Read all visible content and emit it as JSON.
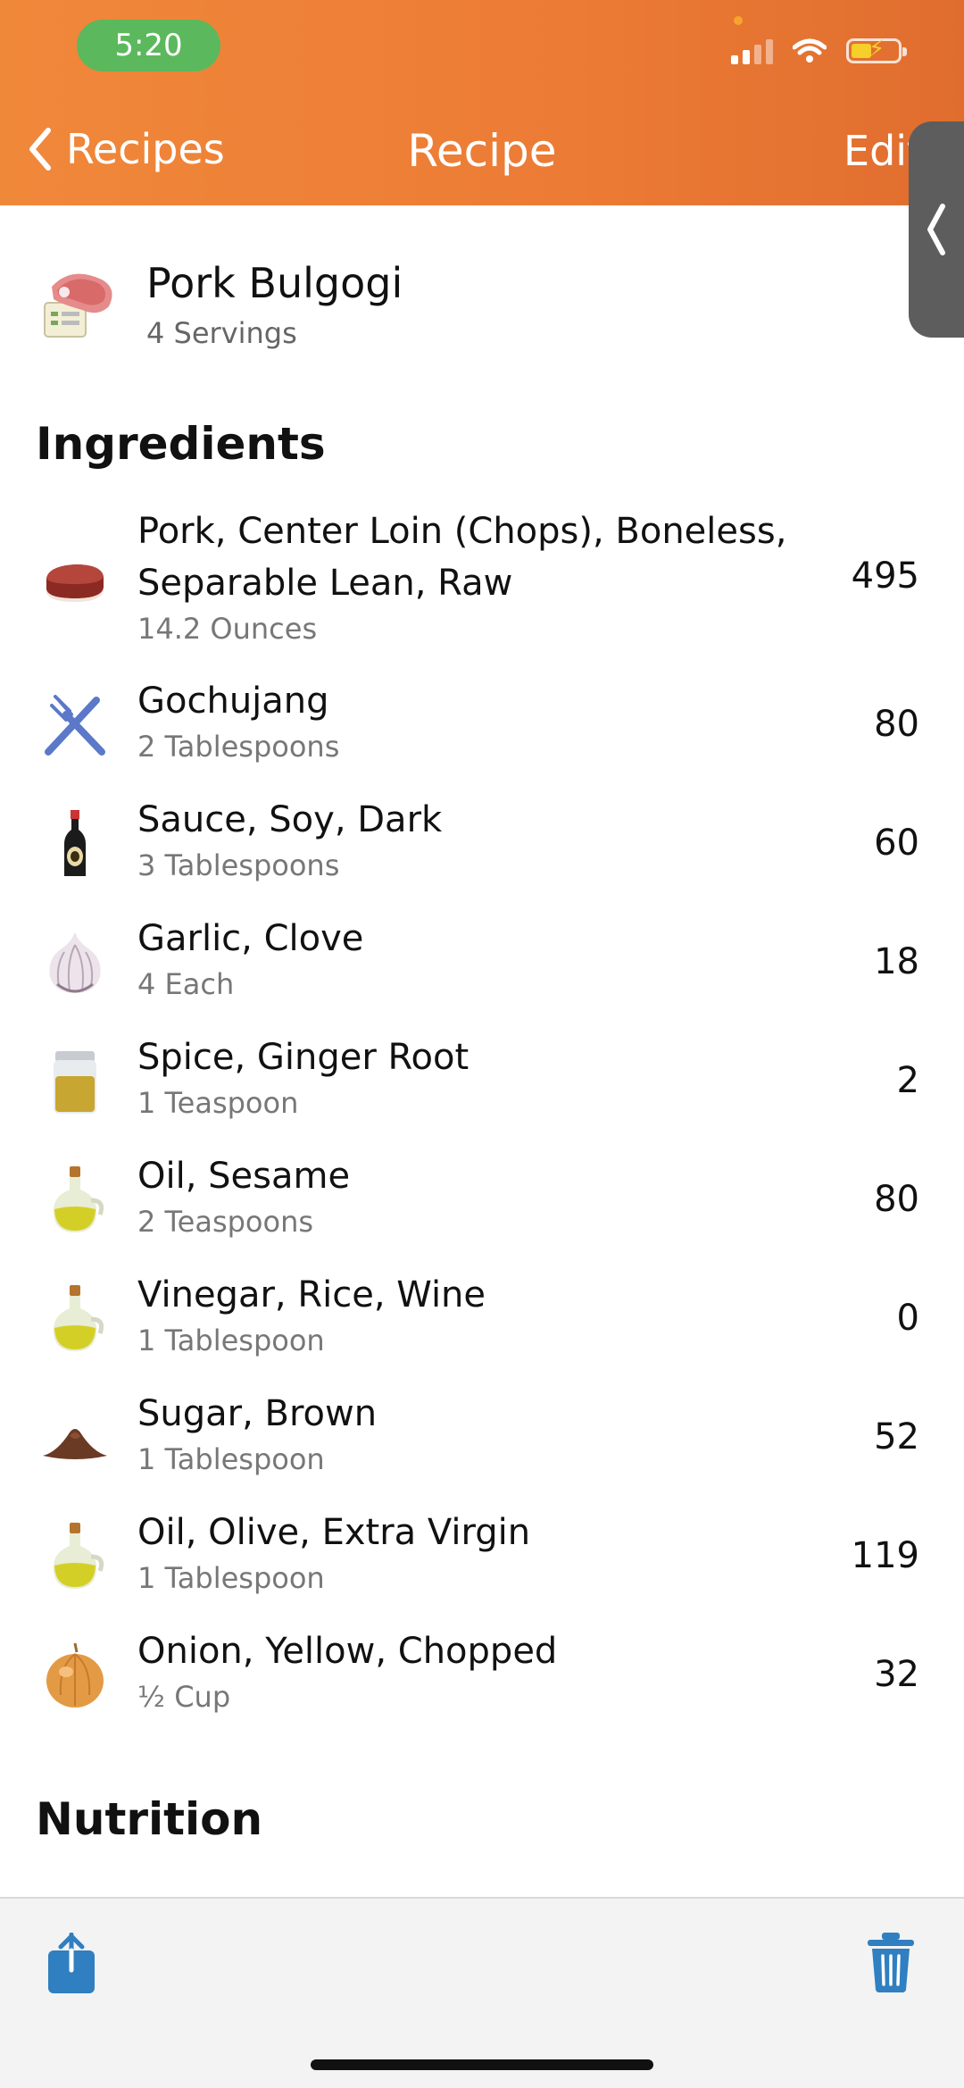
{
  "status_bar": {
    "time": "5:20"
  },
  "nav": {
    "back_label": "Recipes",
    "title": "Recipe",
    "edit_label": "Edit"
  },
  "recipe": {
    "name": "Pork Bulgogi",
    "servings": "4 Servings"
  },
  "sections": {
    "ingredients": "Ingredients",
    "nutrition": "Nutrition"
  },
  "ingredients": [
    {
      "name": "Pork, Center Loin (Chops), Boneless, Separable Lean, Raw",
      "amount": "14.2 Ounces",
      "calories": "495",
      "icon": "meat-icon"
    },
    {
      "name": "Gochujang",
      "amount": "2 Tablespoons",
      "calories": "80",
      "icon": "utensils-icon"
    },
    {
      "name": "Sauce, Soy, Dark",
      "amount": "3 Tablespoons",
      "calories": "60",
      "icon": "soy-sauce-bottle-icon"
    },
    {
      "name": "Garlic, Clove",
      "amount": "4 Each",
      "calories": "18",
      "icon": "garlic-icon"
    },
    {
      "name": "Spice, Ginger Root",
      "amount": "1 Teaspoon",
      "calories": "2",
      "icon": "spice-jar-icon"
    },
    {
      "name": "Oil, Sesame",
      "amount": "2 Teaspoons",
      "calories": "80",
      "icon": "oil-bottle-icon"
    },
    {
      "name": "Vinegar, Rice, Wine",
      "amount": "1 Tablespoon",
      "calories": "0",
      "icon": "oil-bottle-icon"
    },
    {
      "name": "Sugar, Brown",
      "amount": "1 Tablespoon",
      "calories": "52",
      "icon": "brown-sugar-pile-icon"
    },
    {
      "name": "Oil, Olive, Extra Virgin",
      "amount": "1 Tablespoon",
      "calories": "119",
      "icon": "oil-bottle-icon"
    },
    {
      "name": "Onion, Yellow, Chopped",
      "amount": "½ Cup",
      "calories": "32",
      "icon": "onion-icon"
    }
  ],
  "colors": {
    "header_orange": "#ec7b35",
    "toolbar_blue": "#2f7fc1",
    "time_pill_green": "#5cb85c"
  }
}
